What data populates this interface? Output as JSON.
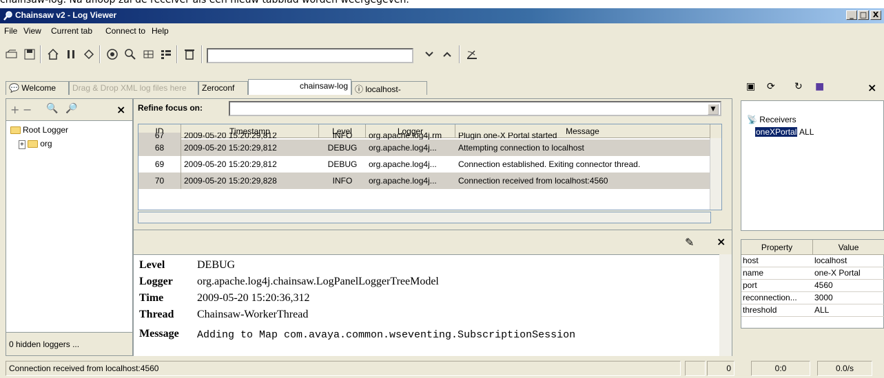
{
  "caption": "chainsaw-log. Na afloop zal de receiver als een nieuw tabblad worden weergegeven.",
  "window": {
    "title": "Chainsaw v2 - Log Viewer",
    "min": "_",
    "max": "□",
    "close": "X"
  },
  "menu": [
    "File",
    "View",
    "Current tab",
    "Connect to",
    "Help"
  ],
  "toolbar": {
    "find_value": ""
  },
  "tabs": [
    {
      "label": "Welcome"
    },
    {
      "label": "Drag & Drop XML log files here"
    },
    {
      "label": "Zeroconf"
    },
    {
      "label": "chainsaw-log"
    },
    {
      "label": "localhost-"
    }
  ],
  "left_panel": {
    "tools": [
      "+",
      "−"
    ],
    "tree": [
      "Root Logger",
      "org"
    ],
    "hidden": "0 hidden loggers  ..."
  },
  "main": {
    "refine_label": "Refine focus on:",
    "refine_value": "",
    "columns": [
      "ID",
      "Timestamp",
      "Level",
      "Logger",
      "Message"
    ],
    "rows": [
      {
        "id": "67",
        "ts": "2009-05-20 15:20:29,812",
        "level": "INFO",
        "logger": "org.apache.log4j.rm",
        "msg": "Plugin one-X Portal started"
      },
      {
        "id": "68",
        "ts": "2009-05-20 15:20:29,812",
        "level": "DEBUG",
        "logger": "org.apache.log4j...",
        "msg": "Attempting connection to localhost"
      },
      {
        "id": "69",
        "ts": "2009-05-20 15:20:29,812",
        "level": "DEBUG",
        "logger": "org.apache.log4j...",
        "msg": "Connection established. Exiting connector thread."
      },
      {
        "id": "70",
        "ts": "2009-05-20 15:20:29,828",
        "level": "INFO",
        "logger": "org.apache.log4j...",
        "msg": "Connection received from localhost:4560"
      }
    ],
    "detail": {
      "level_label": "Level",
      "level": "DEBUG",
      "logger_label": "Logger",
      "logger": "org.apache.log4j.chainsaw.LogPanelLoggerTreeModel",
      "time_label": "Time",
      "time": "2009-05-20 15:20:36,312",
      "thread_label": "Thread",
      "thread": "Chainsaw-WorkerThread",
      "message_label": "Message",
      "message": "Adding to Map com.avaya.common.wseventing.SubscriptionSession"
    }
  },
  "right_panel": {
    "receivers_root": "Receivers",
    "receiver_name": "oneXPortal",
    "receiver_level": "ALL",
    "prop_headers": [
      "Property",
      "Value"
    ],
    "props": [
      {
        "k": "host",
        "v": "localhost"
      },
      {
        "k": "name",
        "v": "one-X Portal"
      },
      {
        "k": "port",
        "v": "4560"
      },
      {
        "k": "reconnection...",
        "v": "3000"
      },
      {
        "k": "threshold",
        "v": "ALL"
      }
    ]
  },
  "status": {
    "message": "Connection received from localhost:4560",
    "count": "0",
    "time": "0:0",
    "rate": "0.0/s"
  },
  "close_glyph": "×"
}
